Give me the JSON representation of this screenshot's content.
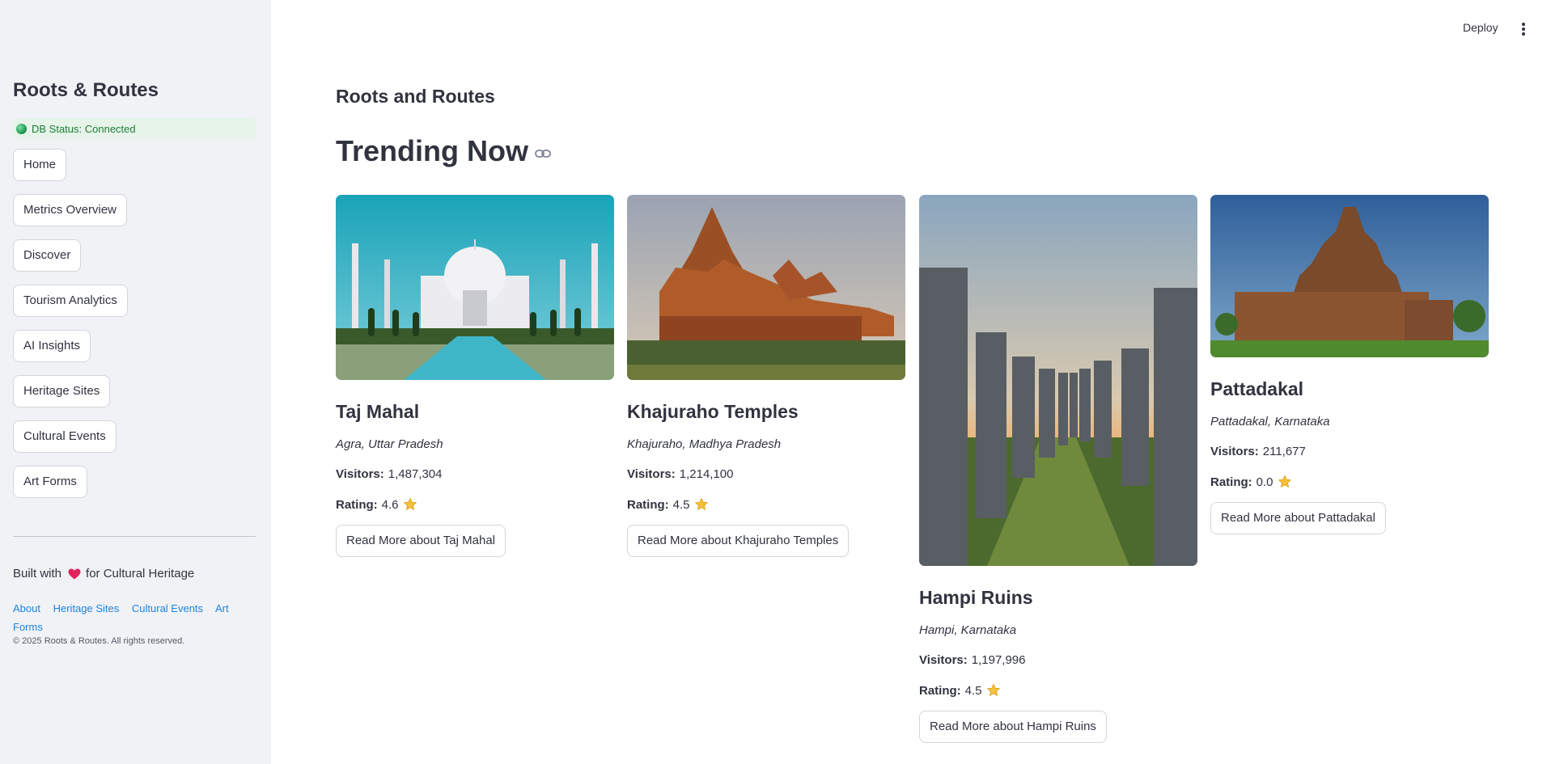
{
  "sidebar": {
    "app_title": "Roots & Routes",
    "db_status": "DB Status: Connected",
    "nav_items": [
      {
        "label": "Home"
      },
      {
        "label": "Metrics Overview"
      },
      {
        "label": "Discover"
      },
      {
        "label": "Tourism Analytics"
      },
      {
        "label": "AI Insights"
      },
      {
        "label": "Heritage Sites"
      },
      {
        "label": "Cultural Events"
      },
      {
        "label": "Art Forms"
      }
    ],
    "built_with_prefix": "Built with",
    "built_with_suffix": "for Cultural Heritage",
    "footer_links": [
      "About",
      "Heritage Sites",
      "Cultural Events",
      "Art Forms"
    ],
    "copyright": "© 2025 Roots & Routes. All rights reserved."
  },
  "header": {
    "deploy_label": "Deploy",
    "menu_icon": "kebab-menu-icon"
  },
  "main": {
    "page_title": "Roots and Routes",
    "section_title": "Trending Now",
    "visitors_label": "Visitors:",
    "rating_label": "Rating:",
    "cards": [
      {
        "name": "Taj Mahal",
        "location": "Agra, Uttar Pradesh",
        "visitors": "1,487,304",
        "rating": "4.6",
        "button": "Read More about Taj Mahal"
      },
      {
        "name": "Khajuraho Temples",
        "location": "Khajuraho, Madhya Pradesh",
        "visitors": "1,214,100",
        "rating": "4.5",
        "button": "Read More about Khajuraho Temples"
      },
      {
        "name": "Hampi Ruins",
        "location": "Hampi, Karnataka",
        "visitors": "1,197,996",
        "rating": "4.5",
        "button": "Read More about Hampi Ruins"
      },
      {
        "name": "Pattadakal",
        "location": "Pattadakal, Karnataka",
        "visitors": "211,677",
        "rating": "0.0",
        "button": "Read More about Pattadakal"
      }
    ]
  },
  "colors": {
    "sidebar_bg": "#f0f2f6",
    "status_bg": "#e6f4ea",
    "status_text": "#1e7e34",
    "link": "#1c83e1",
    "text": "#31333f"
  }
}
